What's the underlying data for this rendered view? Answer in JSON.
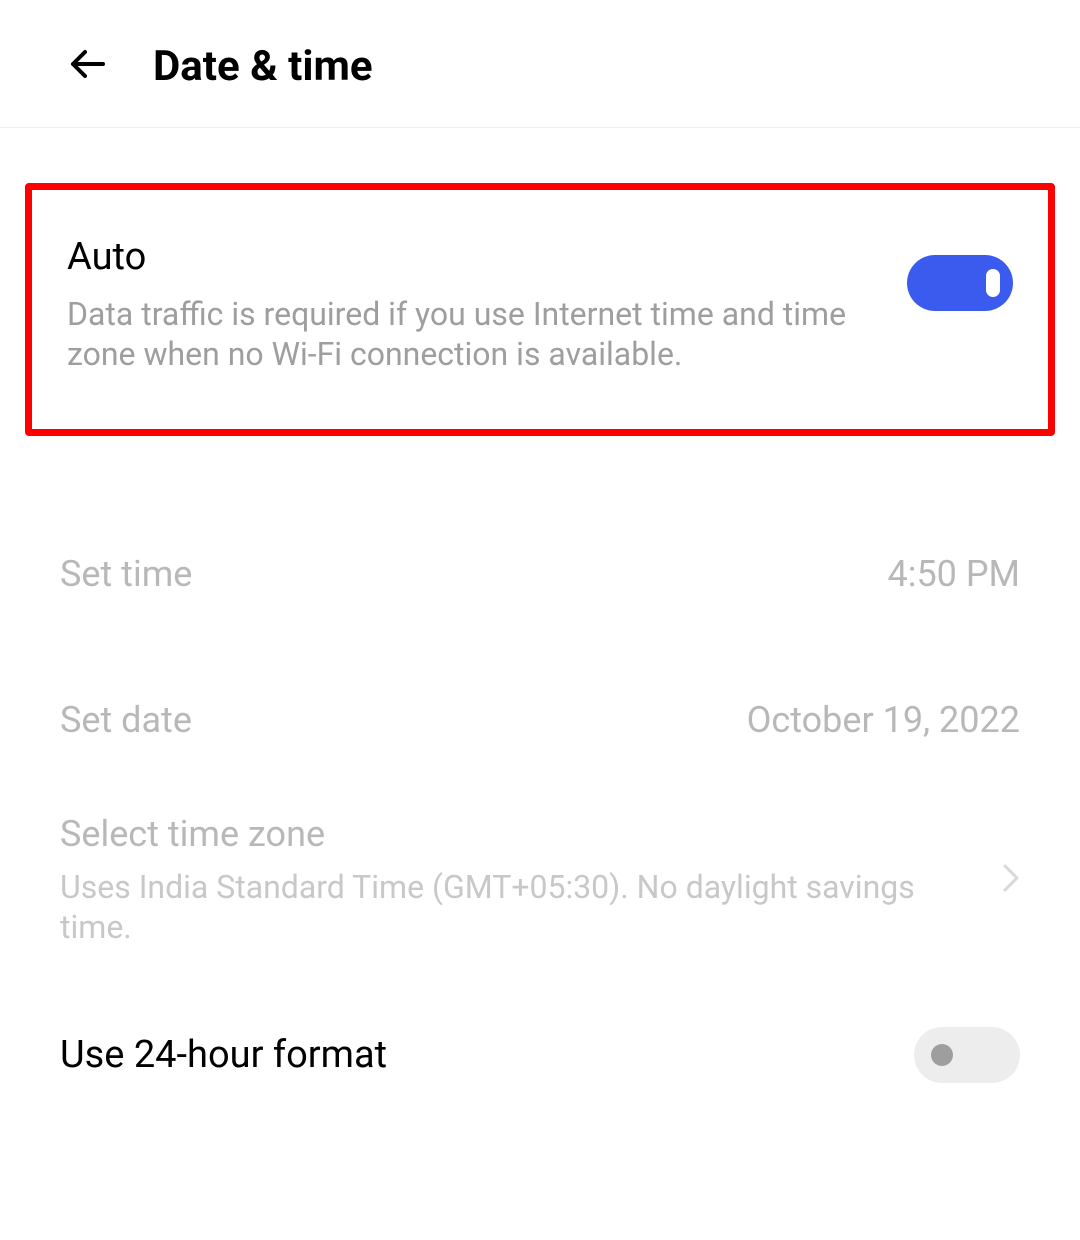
{
  "header": {
    "title": "Date & time"
  },
  "auto": {
    "title": "Auto",
    "description": "Data traffic is required if you use Internet time and time zone when no Wi-Fi connection is available.",
    "enabled": true
  },
  "set_time": {
    "label": "Set time",
    "value": "4:50 PM"
  },
  "set_date": {
    "label": "Set date",
    "value": "October 19, 2022"
  },
  "timezone": {
    "title": "Select time zone",
    "description": "Uses India Standard Time (GMT+05:30). No daylight savings time."
  },
  "hour_format": {
    "label": "Use 24-hour format",
    "enabled": false
  }
}
